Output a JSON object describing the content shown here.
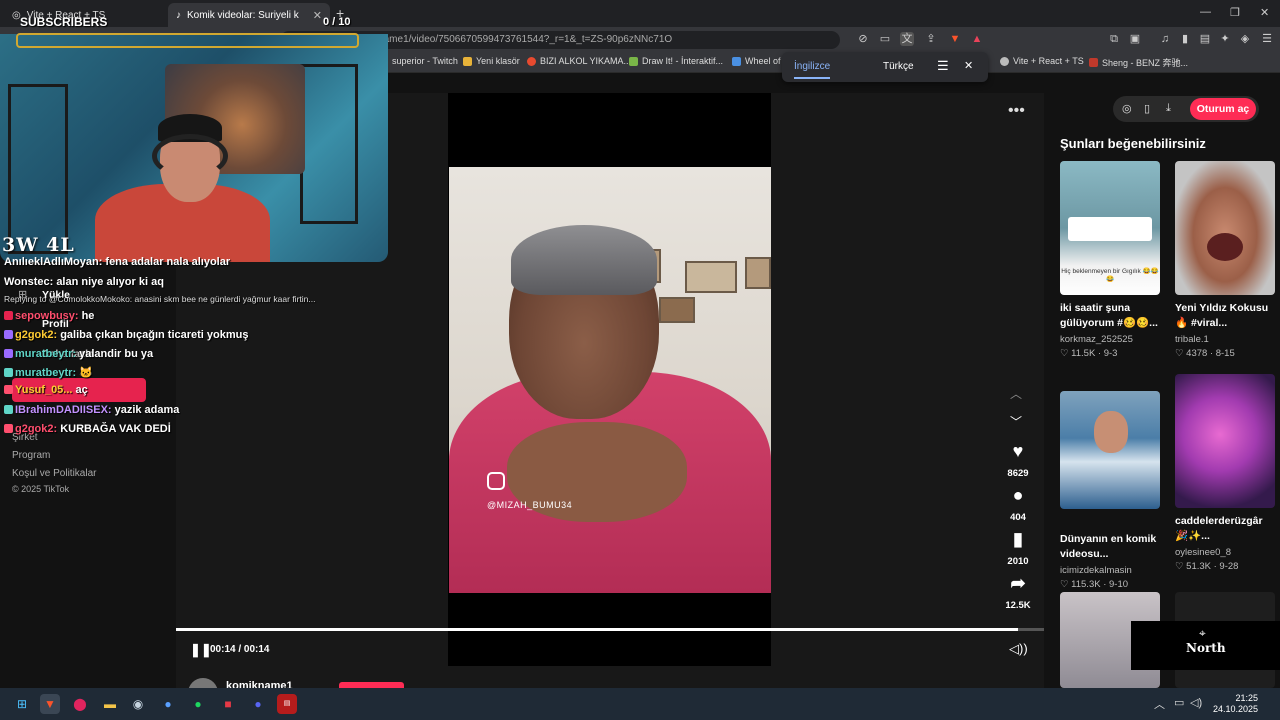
{
  "browser": {
    "tab1_title": "Vite + React + TS",
    "tab2_title": "Komik videolar: Suriyeli kadın",
    "new_tab": "+",
    "address": "tiktok.com/@komikname1/video/7506670599473761544?_r=1&_t=ZS-90p6zNNc71O",
    "bookmarks": [
      {
        "label": "superior - Twitch",
        "color": "#9146ff"
      },
      {
        "label": "Yeni klasör",
        "color": "#e8b339"
      },
      {
        "label": "BIZI ALKOL YIKAMA...",
        "color": "#e84a2f"
      },
      {
        "label": "Draw It! - İnteraktif...",
        "color": "#7ab648"
      },
      {
        "label": "Wheel of N",
        "color": "#4a90e2"
      },
      {
        "label": "Vite + React + TS",
        "color": "#bbbbbb"
      },
      {
        "label": "Sheng - BENZ 奔驰...",
        "color": "#c0392b"
      }
    ],
    "translate": {
      "lang_selected": "İngilizce",
      "lang_other": "Türkçe"
    }
  },
  "overlay": {
    "subscribers": "SUBSCRIBERS",
    "counter": "0 / 10",
    "score": "3W 4L",
    "north": "North",
    "north_icon": "crosshair-icon"
  },
  "chat": [
    {
      "name": "AnılıeklAdlıMoyan:",
      "color": "#ffffff",
      "msg": "fena adalar nala alıyolar"
    },
    {
      "name": "Wonstec:",
      "color": "#ffffff",
      "msg": "alan niye alıyor ki aq"
    },
    {
      "name": "",
      "color": "#dddddd",
      "msg": "Replying to @ComolokkoMokoko: anasini skm bee ne günlerdi yağmur kaar firtin...",
      "small": true
    },
    {
      "name": "sepowbusy:",
      "color": "#ff4f6e",
      "msg": "he"
    },
    {
      "name": "g2gok2:",
      "color": "#ffcc33",
      "msg": "galiba çıkan bıçağın ticareti yokmuş"
    },
    {
      "name": "muratbeytr:",
      "color": "#5fd5c7",
      "msg": "yalandir bu ya"
    },
    {
      "name": "muratbeytr:",
      "color": "#5fd5c7",
      "msg": "🐱"
    },
    {
      "name": "Yusuf_05...",
      "color": "#ffcc33",
      "msg": "aç"
    },
    {
      "name": "IBrahimDADIISEX:",
      "color": "#c392ff",
      "msg": "yazik adama"
    },
    {
      "name": "g2gok2:",
      "color": "#ff4f6e",
      "msg": "KURBAĞA VAK DEDİ"
    }
  ],
  "left_nav": {
    "items": [
      "Yükle",
      "Profil",
      "Daha fazla"
    ],
    "footer": [
      "Şirket",
      "Program",
      "Koşul ve Politikalar",
      "© 2025 TikTok"
    ]
  },
  "video": {
    "watermark": "@MIZAH_BUMU34",
    "likes": "8629",
    "comments": "404",
    "saves": "2010",
    "shares": "12.5K",
    "time": "00:14 / 00:14",
    "progress": 0.97,
    "author": "komikname1"
  },
  "right": {
    "login": "Oturum aç",
    "title": "Şunları beğenebilirsiniz",
    "cards": [
      {
        "caption": "iki saatir şuna gülüyorum #🥴🥴...",
        "user": "korkmaz_252525",
        "stats": "♡ 11.5K · 9-3",
        "thumb_text": "Hiç beklenmeyen bir Gıgılık 😂😂😂"
      },
      {
        "caption": "Yeni Yıldız Kokusu 🔥 #viral...",
        "user": "tribale.1",
        "stats": "♡ 4378 · 8-15",
        "thumb_text": ""
      },
      {
        "caption": "Dünyanın en komik videosu...",
        "user": "icimizdekalmasin",
        "stats": "♡ 115.3K · 9-10",
        "thumb_text": ""
      },
      {
        "caption": "caddelerderüzgâr 🎉✨...",
        "user": "oylesinee0_8",
        "stats": "♡ 51.3K · 9-28",
        "thumb_text": ""
      }
    ]
  },
  "taskbar": {
    "time": "21:25",
    "date": "24.10.2025"
  }
}
